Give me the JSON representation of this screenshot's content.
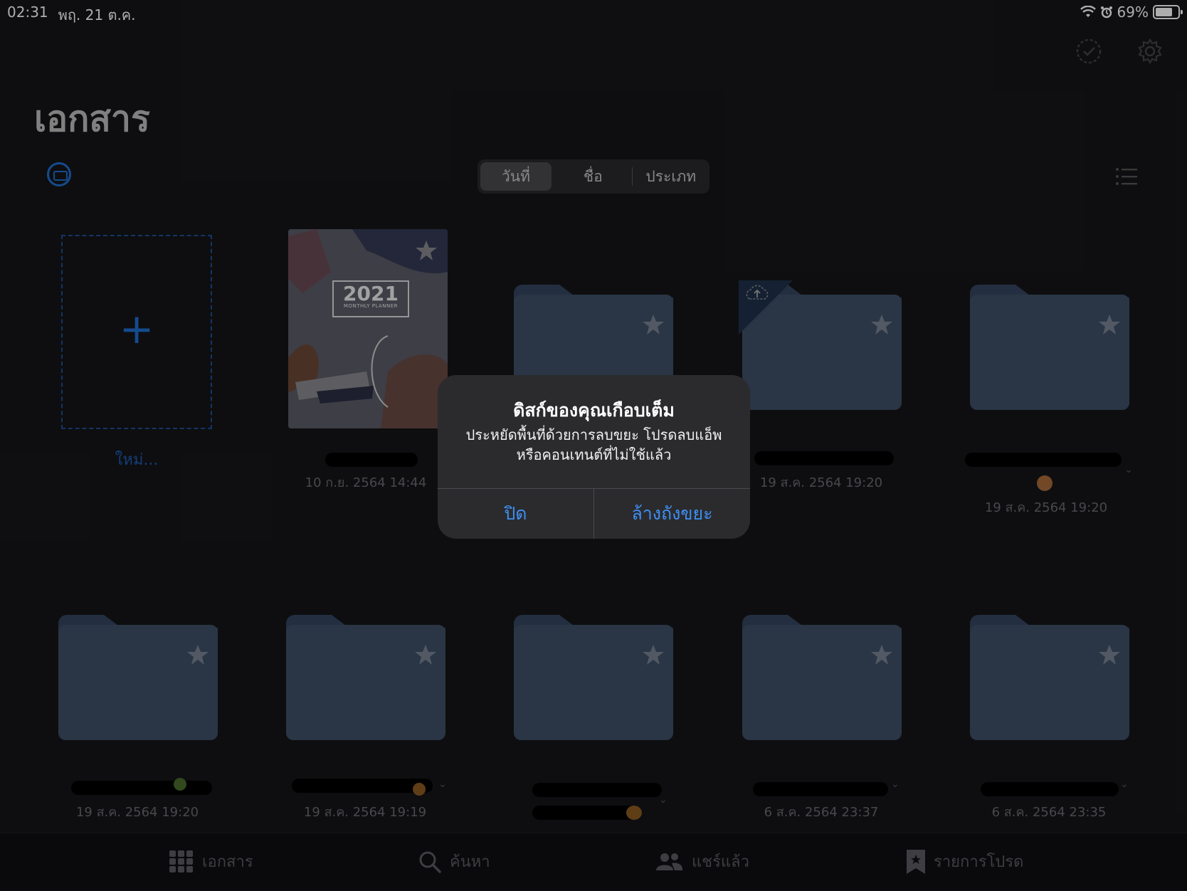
{
  "status_bar": {
    "time": "02:31",
    "date": "พฤ. 21 ต.ค.",
    "battery": "69%",
    "battery_level": 0.69
  },
  "page": {
    "title": "เอกสาร"
  },
  "sort": {
    "options": [
      "วันที่",
      "ชื่อ",
      "ประเภท"
    ],
    "selected": "วันที่"
  },
  "new_document": {
    "label": "ใหม่..."
  },
  "documents": [
    {
      "kind": "notebook",
      "cover_year": "2021",
      "cover_subtitle": "MONTHLY PLANNER",
      "date": "10 ก.ย. 2564 14:44"
    },
    {
      "kind": "folder",
      "date": ""
    },
    {
      "kind": "folder",
      "date": "19 ส.ค. 2564 19:20",
      "cloud_upload": true
    },
    {
      "kind": "folder",
      "date": "19 ส.ค. 2564 19:20"
    },
    {
      "kind": "folder",
      "date": "19 ส.ค. 2564 19:20"
    },
    {
      "kind": "folder",
      "date": "19 ส.ค. 2564 19:19"
    },
    {
      "kind": "folder",
      "date": ""
    },
    {
      "kind": "folder",
      "date": "6 ส.ค. 2564 23:37"
    },
    {
      "kind": "folder",
      "date": "6 ส.ค. 2564 23:35"
    }
  ],
  "tab_bar": [
    {
      "label": "เอกสาร",
      "icon": "grid-icon"
    },
    {
      "label": "ค้นหา",
      "icon": "search-icon"
    },
    {
      "label": "แชร์แล้ว",
      "icon": "people-icon"
    },
    {
      "label": "รายการโปรด",
      "icon": "bookmark-star-icon"
    }
  ],
  "alert": {
    "title": "ดิสก์ของคุณเกือบเต็ม",
    "message_line1": "ประหยัดพื้นที่ด้วยการลบขยะ โปรดลบแอ็พ",
    "message_line2": "หรือคอนเทนต์ที่ไม่ใช้แล้ว",
    "close_label": "ปิด",
    "empty_trash_label": "ล้างถังขยะ"
  },
  "colors": {
    "accent": "#3d8ff2",
    "folder": "#3f5066",
    "background": "#161619"
  }
}
